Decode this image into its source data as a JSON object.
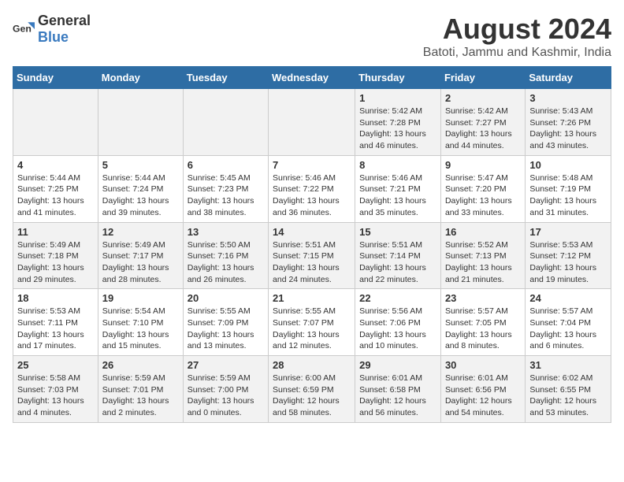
{
  "header": {
    "logo_general": "General",
    "logo_blue": "Blue",
    "month": "August 2024",
    "location": "Batoti, Jammu and Kashmir, India"
  },
  "weekdays": [
    "Sunday",
    "Monday",
    "Tuesday",
    "Wednesday",
    "Thursday",
    "Friday",
    "Saturday"
  ],
  "weeks": [
    [
      {
        "day": "",
        "info": ""
      },
      {
        "day": "",
        "info": ""
      },
      {
        "day": "",
        "info": ""
      },
      {
        "day": "",
        "info": ""
      },
      {
        "day": "1",
        "info": "Sunrise: 5:42 AM\nSunset: 7:28 PM\nDaylight: 13 hours\nand 46 minutes."
      },
      {
        "day": "2",
        "info": "Sunrise: 5:42 AM\nSunset: 7:27 PM\nDaylight: 13 hours\nand 44 minutes."
      },
      {
        "day": "3",
        "info": "Sunrise: 5:43 AM\nSunset: 7:26 PM\nDaylight: 13 hours\nand 43 minutes."
      }
    ],
    [
      {
        "day": "4",
        "info": "Sunrise: 5:44 AM\nSunset: 7:25 PM\nDaylight: 13 hours\nand 41 minutes."
      },
      {
        "day": "5",
        "info": "Sunrise: 5:44 AM\nSunset: 7:24 PM\nDaylight: 13 hours\nand 39 minutes."
      },
      {
        "day": "6",
        "info": "Sunrise: 5:45 AM\nSunset: 7:23 PM\nDaylight: 13 hours\nand 38 minutes."
      },
      {
        "day": "7",
        "info": "Sunrise: 5:46 AM\nSunset: 7:22 PM\nDaylight: 13 hours\nand 36 minutes."
      },
      {
        "day": "8",
        "info": "Sunrise: 5:46 AM\nSunset: 7:21 PM\nDaylight: 13 hours\nand 35 minutes."
      },
      {
        "day": "9",
        "info": "Sunrise: 5:47 AM\nSunset: 7:20 PM\nDaylight: 13 hours\nand 33 minutes."
      },
      {
        "day": "10",
        "info": "Sunrise: 5:48 AM\nSunset: 7:19 PM\nDaylight: 13 hours\nand 31 minutes."
      }
    ],
    [
      {
        "day": "11",
        "info": "Sunrise: 5:49 AM\nSunset: 7:18 PM\nDaylight: 13 hours\nand 29 minutes."
      },
      {
        "day": "12",
        "info": "Sunrise: 5:49 AM\nSunset: 7:17 PM\nDaylight: 13 hours\nand 28 minutes."
      },
      {
        "day": "13",
        "info": "Sunrise: 5:50 AM\nSunset: 7:16 PM\nDaylight: 13 hours\nand 26 minutes."
      },
      {
        "day": "14",
        "info": "Sunrise: 5:51 AM\nSunset: 7:15 PM\nDaylight: 13 hours\nand 24 minutes."
      },
      {
        "day": "15",
        "info": "Sunrise: 5:51 AM\nSunset: 7:14 PM\nDaylight: 13 hours\nand 22 minutes."
      },
      {
        "day": "16",
        "info": "Sunrise: 5:52 AM\nSunset: 7:13 PM\nDaylight: 13 hours\nand 21 minutes."
      },
      {
        "day": "17",
        "info": "Sunrise: 5:53 AM\nSunset: 7:12 PM\nDaylight: 13 hours\nand 19 minutes."
      }
    ],
    [
      {
        "day": "18",
        "info": "Sunrise: 5:53 AM\nSunset: 7:11 PM\nDaylight: 13 hours\nand 17 minutes."
      },
      {
        "day": "19",
        "info": "Sunrise: 5:54 AM\nSunset: 7:10 PM\nDaylight: 13 hours\nand 15 minutes."
      },
      {
        "day": "20",
        "info": "Sunrise: 5:55 AM\nSunset: 7:09 PM\nDaylight: 13 hours\nand 13 minutes."
      },
      {
        "day": "21",
        "info": "Sunrise: 5:55 AM\nSunset: 7:07 PM\nDaylight: 13 hours\nand 12 minutes."
      },
      {
        "day": "22",
        "info": "Sunrise: 5:56 AM\nSunset: 7:06 PM\nDaylight: 13 hours\nand 10 minutes."
      },
      {
        "day": "23",
        "info": "Sunrise: 5:57 AM\nSunset: 7:05 PM\nDaylight: 13 hours\nand 8 minutes."
      },
      {
        "day": "24",
        "info": "Sunrise: 5:57 AM\nSunset: 7:04 PM\nDaylight: 13 hours\nand 6 minutes."
      }
    ],
    [
      {
        "day": "25",
        "info": "Sunrise: 5:58 AM\nSunset: 7:03 PM\nDaylight: 13 hours\nand 4 minutes."
      },
      {
        "day": "26",
        "info": "Sunrise: 5:59 AM\nSunset: 7:01 PM\nDaylight: 13 hours\nand 2 minutes."
      },
      {
        "day": "27",
        "info": "Sunrise: 5:59 AM\nSunset: 7:00 PM\nDaylight: 13 hours\nand 0 minutes."
      },
      {
        "day": "28",
        "info": "Sunrise: 6:00 AM\nSunset: 6:59 PM\nDaylight: 12 hours\nand 58 minutes."
      },
      {
        "day": "29",
        "info": "Sunrise: 6:01 AM\nSunset: 6:58 PM\nDaylight: 12 hours\nand 56 minutes."
      },
      {
        "day": "30",
        "info": "Sunrise: 6:01 AM\nSunset: 6:56 PM\nDaylight: 12 hours\nand 54 minutes."
      },
      {
        "day": "31",
        "info": "Sunrise: 6:02 AM\nSunset: 6:55 PM\nDaylight: 12 hours\nand 53 minutes."
      }
    ]
  ]
}
